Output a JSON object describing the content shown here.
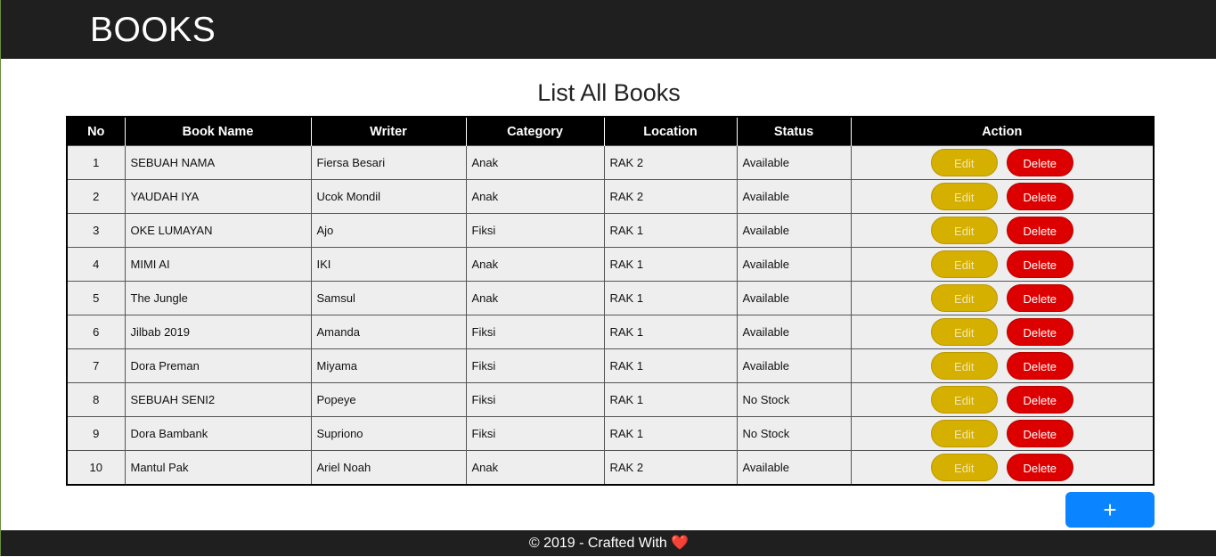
{
  "navbar": {
    "brand": "BOOKS"
  },
  "page": {
    "title": "List All Books"
  },
  "table": {
    "headers": [
      "No",
      "Book Name",
      "Writer",
      "Category",
      "Location",
      "Status",
      "Action"
    ],
    "rows": [
      {
        "no": "1",
        "name": "SEBUAH NAMA",
        "writer": "Fiersa Besari",
        "category": "Anak",
        "location": "RAK 2",
        "status": "Available"
      },
      {
        "no": "2",
        "name": "YAUDAH IYA",
        "writer": "Ucok Mondil",
        "category": "Anak",
        "location": "RAK 2",
        "status": "Available"
      },
      {
        "no": "3",
        "name": "OKE LUMAYAN",
        "writer": "Ajo",
        "category": "Fiksi",
        "location": "RAK 1",
        "status": "Available"
      },
      {
        "no": "4",
        "name": "MIMI AI",
        "writer": "IKI",
        "category": "Anak",
        "location": "RAK 1",
        "status": "Available"
      },
      {
        "no": "5",
        "name": "The Jungle",
        "writer": "Samsul",
        "category": "Anak",
        "location": "RAK 1",
        "status": "Available"
      },
      {
        "no": "6",
        "name": "Jilbab 2019",
        "writer": "Amanda",
        "category": "Fiksi",
        "location": "RAK 1",
        "status": "Available"
      },
      {
        "no": "7",
        "name": "Dora Preman",
        "writer": "Miyama",
        "category": "Fiksi",
        "location": "RAK 1",
        "status": "Available"
      },
      {
        "no": "8",
        "name": "SEBUAH SENI2",
        "writer": "Popeye",
        "category": "Fiksi",
        "location": "RAK 1",
        "status": "No Stock"
      },
      {
        "no": "9",
        "name": "Dora Bambank",
        "writer": "Supriono",
        "category": "Fiksi",
        "location": "RAK 1",
        "status": "No Stock"
      },
      {
        "no": "10",
        "name": "Mantul Pak",
        "writer": "Ariel Noah",
        "category": "Anak",
        "location": "RAK 2",
        "status": "Available"
      }
    ],
    "edit_label": "Edit",
    "delete_label": "Delete"
  },
  "add_button": {
    "label": "+"
  },
  "footer": {
    "text": "© 2019 - Crafted With",
    "heart": "❤️"
  },
  "colors": {
    "navbar": "#1f1f1f",
    "edit_button": "#d6b000",
    "delete_button": "#dd0000",
    "add_button": "#0a84ff"
  }
}
